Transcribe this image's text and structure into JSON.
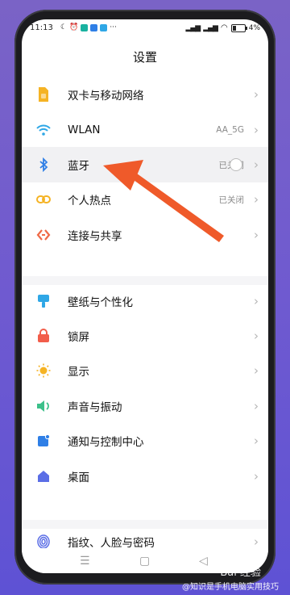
{
  "status_bar": {
    "time": "11:13",
    "battery": "4%",
    "signal": "signal-icons"
  },
  "page_title": "设置",
  "sections": [
    {
      "items": [
        {
          "label": "双卡与移动网络",
          "value": "",
          "icon": "sim-card-icon",
          "color": "#f5b324"
        },
        {
          "label": "WLAN",
          "value": "AA_5G",
          "icon": "wifi-icon",
          "color": "#2fa7e6"
        },
        {
          "label": "蓝牙",
          "value": "已关闭",
          "icon": "bluetooth-icon",
          "color": "#2f7fe6"
        },
        {
          "label": "个人热点",
          "value": "已关闭",
          "icon": "hotspot-icon",
          "color": "#f5b324"
        },
        {
          "label": "连接与共享",
          "value": "",
          "icon": "connection-share-icon",
          "color": "#ef6a47"
        }
      ]
    },
    {
      "items": [
        {
          "label": "壁纸与个性化",
          "value": "",
          "icon": "wallpaper-icon",
          "color": "#2fa7e6"
        },
        {
          "label": "锁屏",
          "value": "",
          "icon": "lock-icon",
          "color": "#f25d4a"
        },
        {
          "label": "显示",
          "value": "",
          "icon": "sun-icon",
          "color": "#f5b324"
        },
        {
          "label": "声音与振动",
          "value": "",
          "icon": "speaker-icon",
          "color": "#3cc08a"
        },
        {
          "label": "通知与控制中心",
          "value": "",
          "icon": "notification-icon",
          "color": "#2f7fe6"
        },
        {
          "label": "桌面",
          "value": "",
          "icon": "home-icon",
          "color": "#5b6ee6"
        }
      ]
    },
    {
      "items": [
        {
          "label": "指纹、人脸与密码",
          "value": "",
          "icon": "fingerprint-icon",
          "color": "#5b6ee6"
        }
      ]
    }
  ],
  "watermark": {
    "logo": "Bai 经验",
    "text": "@知识是手机电脑实用技巧"
  },
  "annotation": {
    "arrow_color": "#ef5a2a"
  }
}
